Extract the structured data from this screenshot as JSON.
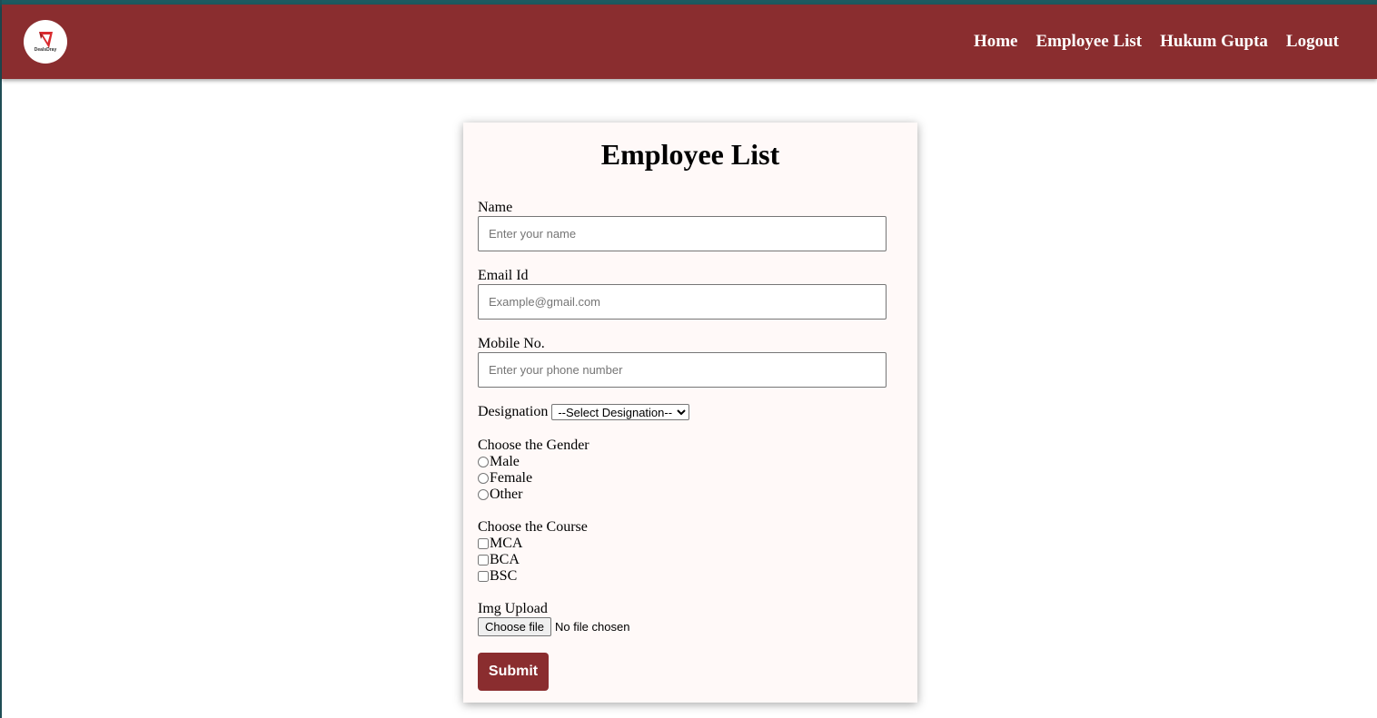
{
  "navbar": {
    "logo_text": "DealsDray",
    "links": [
      "Home",
      "Employee List",
      "Hukum Gupta",
      "Logout"
    ]
  },
  "form": {
    "title": "Employee List",
    "name_label": "Name",
    "name_placeholder": "Enter your name",
    "email_label": "Email Id",
    "email_placeholder": "Example@gmail.com",
    "mobile_label": "Mobile No.",
    "mobile_placeholder": "Enter your phone number",
    "designation_label": "Designation",
    "designation_selected": "--Select Designation--",
    "gender_label": "Choose the Gender",
    "gender_options": [
      "Male",
      "Female",
      "Other"
    ],
    "course_label": "Choose the Course",
    "course_options": [
      "MCA",
      "BCA",
      "BSC"
    ],
    "upload_label": "Img Upload",
    "upload_button": "Choose file",
    "upload_status": "No file chosen",
    "submit_label": "Submit"
  },
  "colors": {
    "brand": "#8a2d2f",
    "top_strip": "#1d5a60",
    "card_background": "#fff9f8"
  }
}
